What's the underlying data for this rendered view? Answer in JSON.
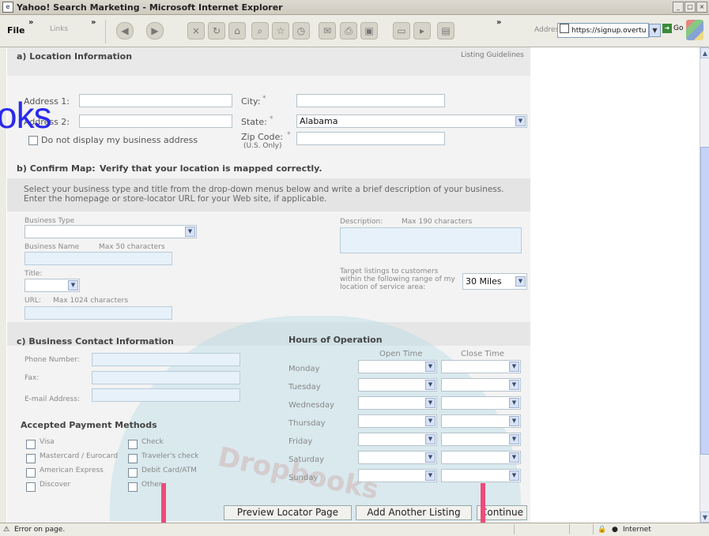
{
  "window": {
    "title": "Yahoo! Search Marketing - Microsoft Internet Explorer"
  },
  "toolbar": {
    "file_label": "File",
    "links_label": "Links",
    "address_label": "Address",
    "address_value": "https://signup.overtu",
    "go_label": "Go"
  },
  "watermark_text": "oks",
  "sectionA": {
    "title": "a) Location Information",
    "guidelines_link": "Listing Guidelines",
    "address1_label": "Address 1:",
    "address2_label": "Address 2:",
    "city_label": "City:",
    "state_label": "State:",
    "state_value": "Alabama",
    "no_display_label": "Do not display my business address",
    "zip_label": "Zip Code:",
    "zip_note": "(U.S. Only)",
    "required_mark": "*"
  },
  "sectionB": {
    "title_prefix": "b) Confirm Map:",
    "title_rest": "Verify that your location is mapped correctly.",
    "instructions": "Select your business type and title from the drop-down menus below and write a brief description of your business. Enter the homepage or store-locator URL for your Web site, if applicable.",
    "business_type_label": "Business Type",
    "business_name_label": "Business Name",
    "business_name_hint": "Max 50 characters",
    "title_label": "Title:",
    "url_label": "URL:",
    "url_hint": "Max 1024 characters",
    "description_label": "Description:",
    "description_hint": "Max 190 characters",
    "target_label": "Target listings to customers within the following range of my location of service area:",
    "target_value": "30 Miles"
  },
  "sectionC": {
    "title": "c) Business Contact Information",
    "phone_label": "Phone Number:",
    "fax_label": "Fax:",
    "email_label": "E-mail Address:"
  },
  "payment": {
    "title": "Accepted Payment Methods",
    "methods_left": [
      "Visa",
      "Mastercard / Eurocard",
      "American Express",
      "Discover"
    ],
    "methods_right": [
      "Check",
      "Traveler's check",
      "Debit Card/ATM",
      "Other"
    ]
  },
  "hours": {
    "title": "Hours of Operation",
    "open_label": "Open Time",
    "close_label": "Close Time",
    "days": [
      "Monday",
      "Tuesday",
      "Wednesday",
      "Thursday",
      "Friday",
      "Saturday",
      "Sunday"
    ]
  },
  "buttons": {
    "preview": "Preview Locator Page",
    "add_another": "Add Another Listing",
    "continue": "Continue"
  },
  "status": {
    "left": "Error on page.",
    "zone": "Internet"
  }
}
